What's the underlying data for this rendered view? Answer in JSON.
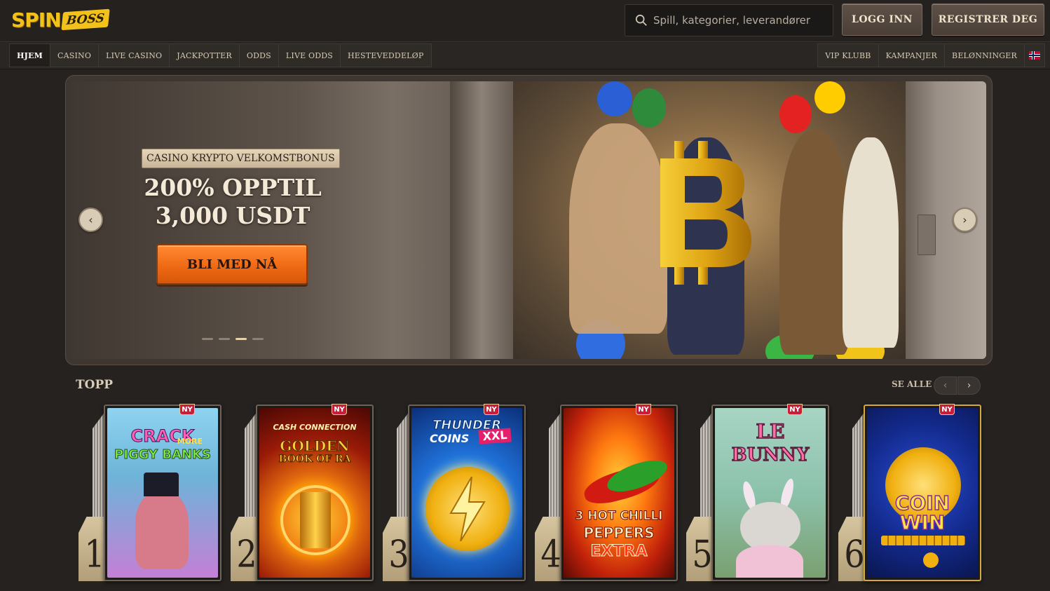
{
  "header": {
    "logo_primary": "SPIN",
    "logo_secondary": "BOSS",
    "search_placeholder": "Spill, kategorier, leverandører",
    "login_label": "LOGG INN",
    "register_label": "REGISTRER DEG"
  },
  "nav": {
    "left_items": [
      {
        "label": "HJEM",
        "active": true
      },
      {
        "label": "CASINO"
      },
      {
        "label": "LIVE CASINO"
      },
      {
        "label": "JACKPOTTER"
      },
      {
        "label": "ODDS"
      },
      {
        "label": "LIVE ODDS"
      },
      {
        "label": "HESTEVEDDELØP"
      }
    ],
    "right_items": [
      {
        "label": "VIP KLUBB"
      },
      {
        "label": "KAMPANJER"
      },
      {
        "label": "BELØNNINGER"
      }
    ],
    "language_icon": "norway-flag-icon"
  },
  "hero": {
    "badge": "CASINO KRYPTO VELKOMSTBONUS",
    "title_line1": "200% OPPTIL",
    "title_line2": "3,000 USDT",
    "cta_label": "BLI MED NÅ",
    "slide_count": 4,
    "active_slide": 3
  },
  "top_section": {
    "title": "TOPP",
    "see_all_label": "SE ALLE",
    "games": [
      {
        "rank": "1",
        "badge": "NY",
        "title_a": "CRACK",
        "title_b": "MORE",
        "title_c": "PIGGY BANKS",
        "bg": "#7fc6e8"
      },
      {
        "rank": "2",
        "badge": "NY",
        "title_a": "CASH CONNECTION",
        "title_b": "GOLDEN",
        "title_c": "BOOK OF RA",
        "bg": "#8b1a0b"
      },
      {
        "rank": "3",
        "badge": "NY",
        "title_a": "THUNDER",
        "title_b": "COINS",
        "title_c": "XXL",
        "bg": "#1f6fd6"
      },
      {
        "rank": "4",
        "badge": "NY",
        "title_a": "3 HOT CHILLI",
        "title_b": "PEPPERS",
        "title_c": "EXTRA",
        "bg": "#d9420e"
      },
      {
        "rank": "5",
        "badge": "NY",
        "title_a": "LE",
        "title_b": "BUNNY",
        "title_c": "",
        "bg": "#9ec9b5"
      },
      {
        "rank": "6",
        "badge": "NY",
        "title_a": "COIN",
        "title_b": "WIN",
        "title_c": "",
        "bg": "#132a8c"
      }
    ]
  },
  "colors": {
    "accent": "#f3c21a",
    "cta": "#f06a14",
    "badge_new": "#c81e3a",
    "background": "#252220"
  }
}
